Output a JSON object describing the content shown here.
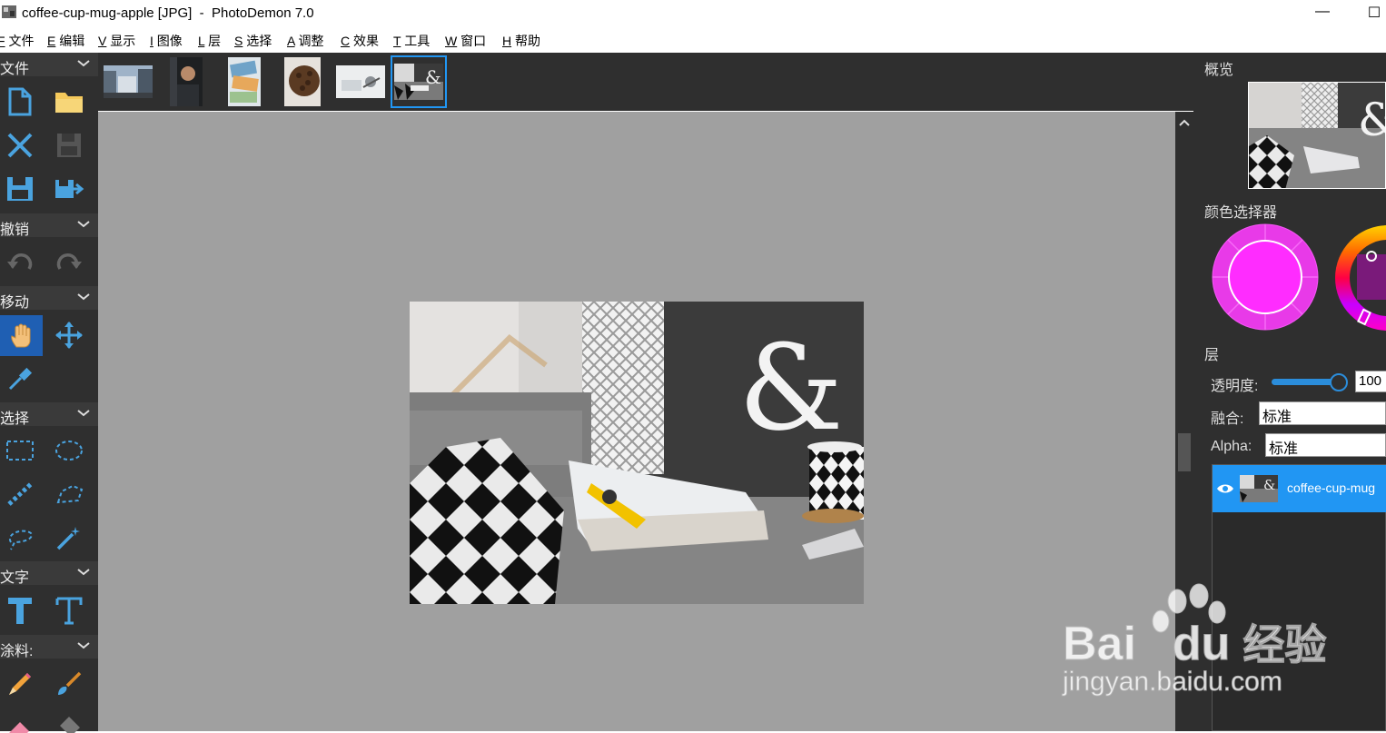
{
  "window": {
    "title": "coffee-cup-mug-apple [JPG]  -  PhotoDemon 7.0",
    "minimize_glyph": "—",
    "maximize_glyph": "☐"
  },
  "menubar": {
    "items": [
      {
        "key": "F",
        "label": "文件"
      },
      {
        "key": "E",
        "label": "编辑"
      },
      {
        "key": "V",
        "label": "显示"
      },
      {
        "key": "I",
        "label": "图像"
      },
      {
        "key": "L",
        "label": "层"
      },
      {
        "key": "S",
        "label": "选择"
      },
      {
        "key": "A",
        "label": "调整"
      },
      {
        "key": "C",
        "label": "效果"
      },
      {
        "key": "T",
        "label": "工具"
      },
      {
        "key": "W",
        "label": "窗口"
      },
      {
        "key": "H",
        "label": "帮助"
      }
    ]
  },
  "toolbox": {
    "sections": {
      "file": "文件",
      "undo": "撤销",
      "move": "移动",
      "select": "选择",
      "text": "文字",
      "paint": "涂料:"
    },
    "active_tool": "hand-tool",
    "accent": "#1f5fb3",
    "icon_color": "#4aa3df"
  },
  "thumbnails": {
    "items": [
      {
        "name": "city-street"
      },
      {
        "name": "dark-portrait"
      },
      {
        "name": "money-notes"
      },
      {
        "name": "coffee-beans"
      },
      {
        "name": "white-desk"
      },
      {
        "name": "coffee-cup-mug-apple",
        "active": true
      }
    ],
    "active_border": "#2196f3"
  },
  "right_panel": {
    "overview_title": "概览",
    "color_picker_title": "颜色选择器",
    "selected_color": "#ff2cff",
    "layers_title": "层",
    "opacity_label": "透明度:",
    "opacity_value": "100",
    "opacity_fraction": 1.0,
    "blend_label": "融合:",
    "blend_value": "标准",
    "alpha_label": "Alpha:",
    "alpha_value": "标准",
    "layer_name": "coffee-cup-mug",
    "layer_visible_icon": "eye-icon"
  },
  "watermark": {
    "brand": "Bai",
    "brand2": "du",
    "cn": "经验",
    "url": "jingyan.baidu.com"
  }
}
